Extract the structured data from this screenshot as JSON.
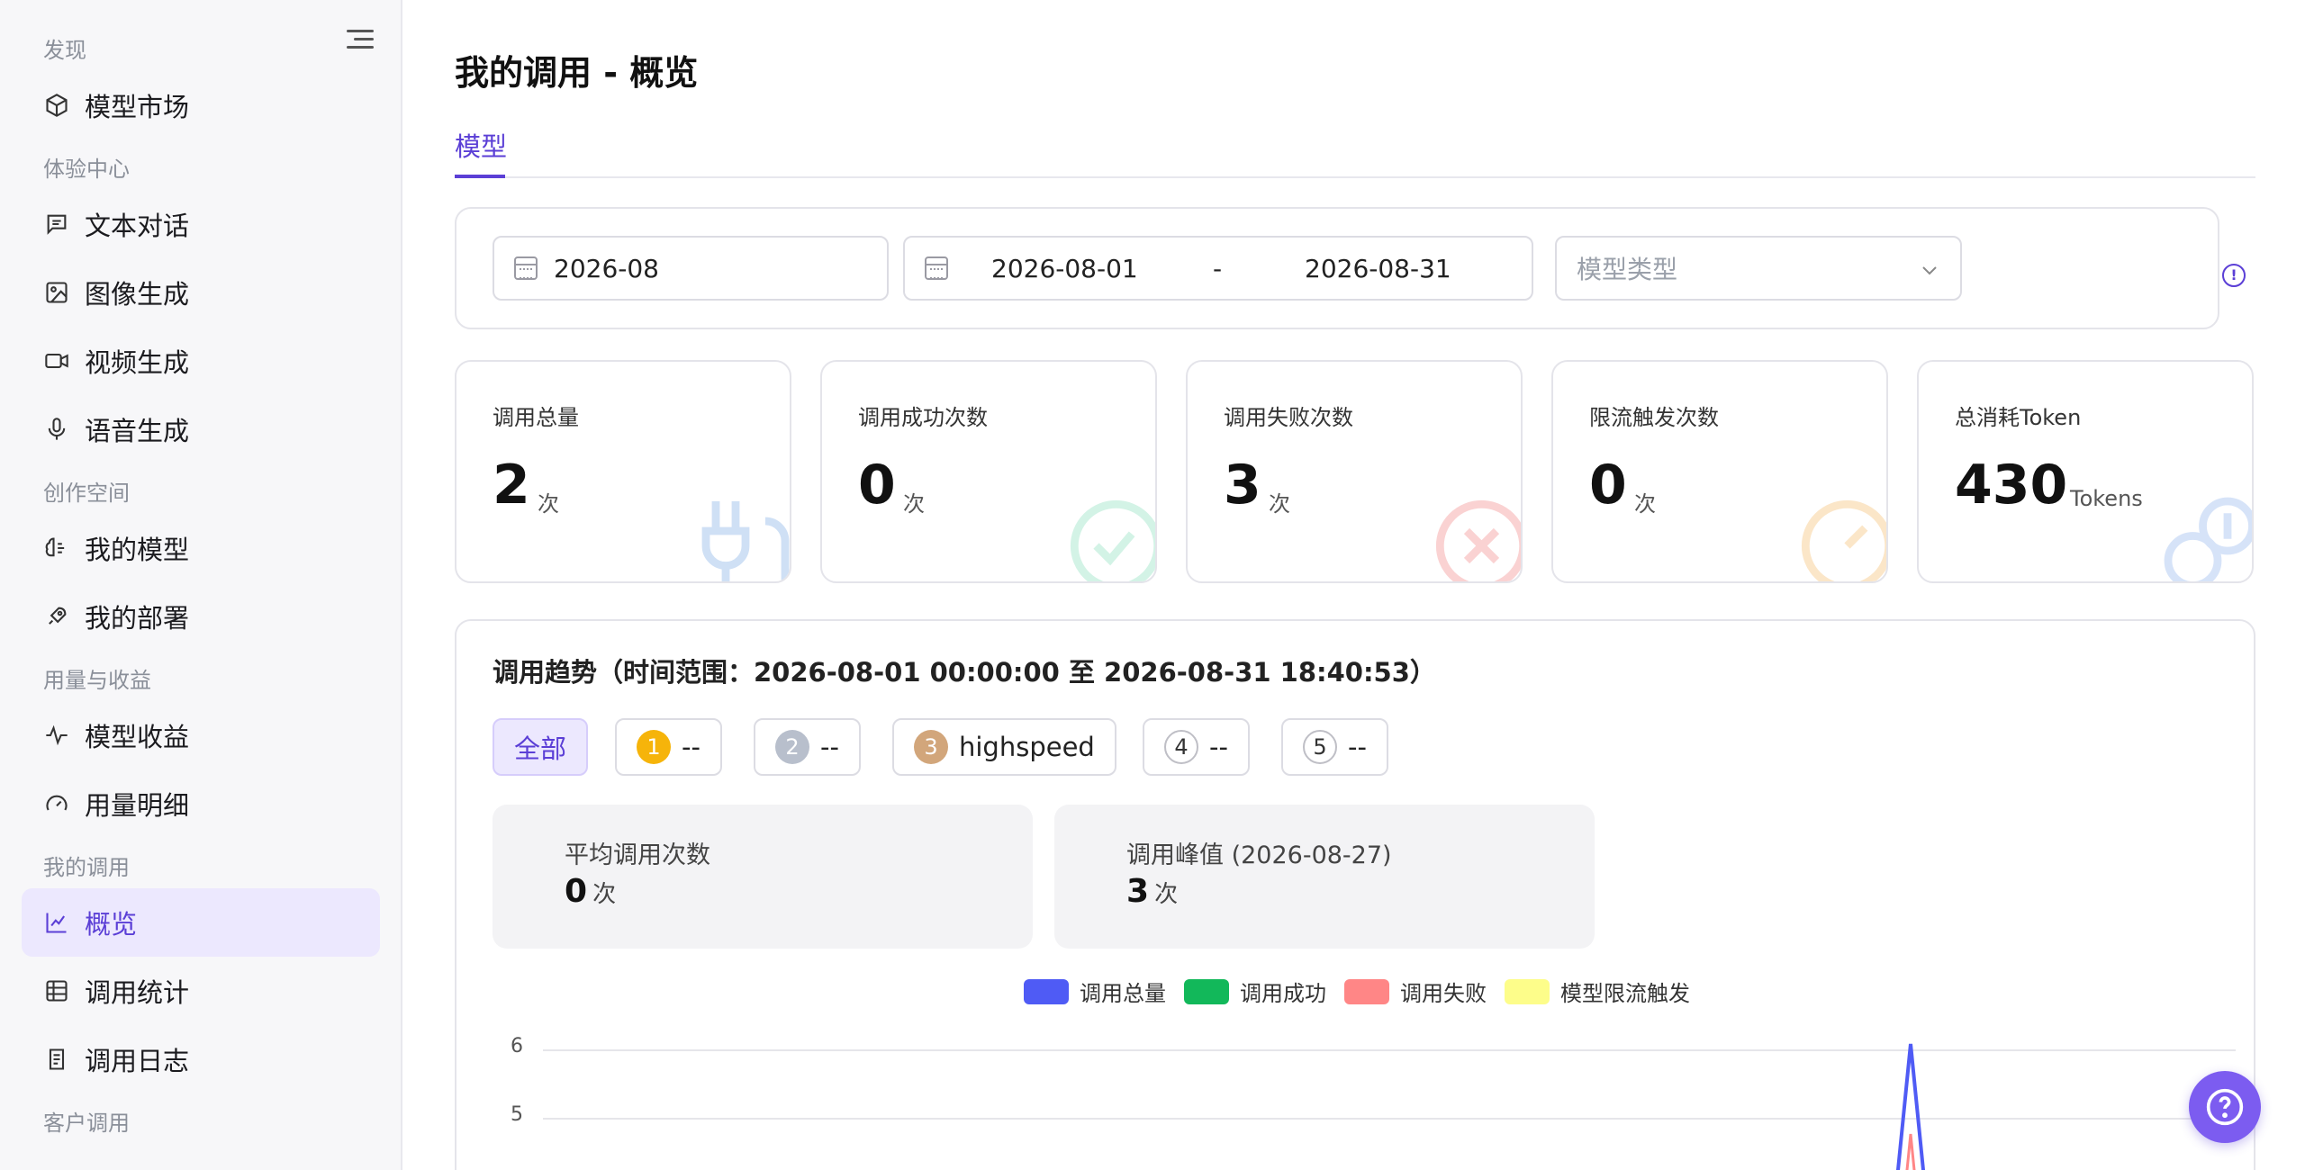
{
  "sidebar": {
    "sections": [
      "发现",
      "体验中心",
      "创作空间",
      "用量与收益",
      "我的调用",
      "客户调用"
    ],
    "items": [
      {
        "label": "模型市场",
        "icon": "model-market-icon"
      },
      {
        "label": "文本对话",
        "icon": "chat-icon"
      },
      {
        "label": "图像生成",
        "icon": "image-icon"
      },
      {
        "label": "视频生成",
        "icon": "video-icon"
      },
      {
        "label": "语音生成",
        "icon": "mic-icon"
      },
      {
        "label": "我的模型",
        "icon": "brain-icon"
      },
      {
        "label": "我的部署",
        "icon": "rocket-icon"
      },
      {
        "label": "模型收益",
        "icon": "pulse-icon"
      },
      {
        "label": "用量明细",
        "icon": "gauge-icon"
      },
      {
        "label": "概览",
        "icon": "line-chart-icon",
        "active": true
      },
      {
        "label": "调用统计",
        "icon": "table-icon"
      },
      {
        "label": "调用日志",
        "icon": "log-icon"
      }
    ]
  },
  "page": {
    "title": "我的调用 - 概览",
    "tab": "模型"
  },
  "filters": {
    "month": "2026-08",
    "range_start": "2026-08-01",
    "range_sep": "-",
    "range_end": "2026-08-31",
    "model_type_placeholder": "模型类型"
  },
  "stats": [
    {
      "title": "调用总量",
      "value": "2",
      "unit": "次",
      "icon": "plug-icon",
      "color": "#7fb0e6"
    },
    {
      "title": "调用成功次数",
      "value": "0",
      "unit": "次",
      "icon": "check-circle-icon",
      "color": "#6cd3a8"
    },
    {
      "title": "调用失败次数",
      "value": "3",
      "unit": "次",
      "icon": "x-circle-icon",
      "color": "#f08a8a"
    },
    {
      "title": "限流触发次数",
      "value": "0",
      "unit": "次",
      "icon": "speed-icon",
      "color": "#f4c27a"
    },
    {
      "title": "总消耗Token",
      "value": "430",
      "unit": "Tokens",
      "icon": "tokens-icon",
      "color": "#8fb4ec"
    }
  ],
  "trend": {
    "title": "调用趋势（时间范围：2026-08-01 00:00:00 至 2026-08-31 18:40:53）",
    "pills": [
      {
        "label": "全部",
        "active": true
      },
      {
        "rank": "1",
        "label": "--",
        "color": "#f6b40a"
      },
      {
        "rank": "2",
        "label": "--",
        "color": "#b8bfcc"
      },
      {
        "rank": "3",
        "label": "highspeed",
        "color": "#d2a67b"
      },
      {
        "rank": "4",
        "label": "--"
      },
      {
        "rank": "5",
        "label": "--"
      }
    ],
    "avg": {
      "title": "平均调用次数",
      "value": "0",
      "unit": "次"
    },
    "peak": {
      "title": "调用峰值 (2026-08-27)",
      "value": "3",
      "unit": "次"
    },
    "legend": [
      {
        "label": "调用总量",
        "color": "#4f5bf5"
      },
      {
        "label": "调用成功",
        "color": "#12b85a"
      },
      {
        "label": "调用失败",
        "color": "#ff8686"
      },
      {
        "label": "模型限流触发",
        "color": "#fdfd8a"
      }
    ]
  },
  "chart_data": {
    "type": "line",
    "y_ticks_visible": [
      "6",
      "5"
    ],
    "series": [
      {
        "name": "调用总量",
        "color": "#4f5bf5"
      },
      {
        "name": "调用失败",
        "color": "#ff8686"
      }
    ],
    "peak_date": "2026-08-27"
  }
}
